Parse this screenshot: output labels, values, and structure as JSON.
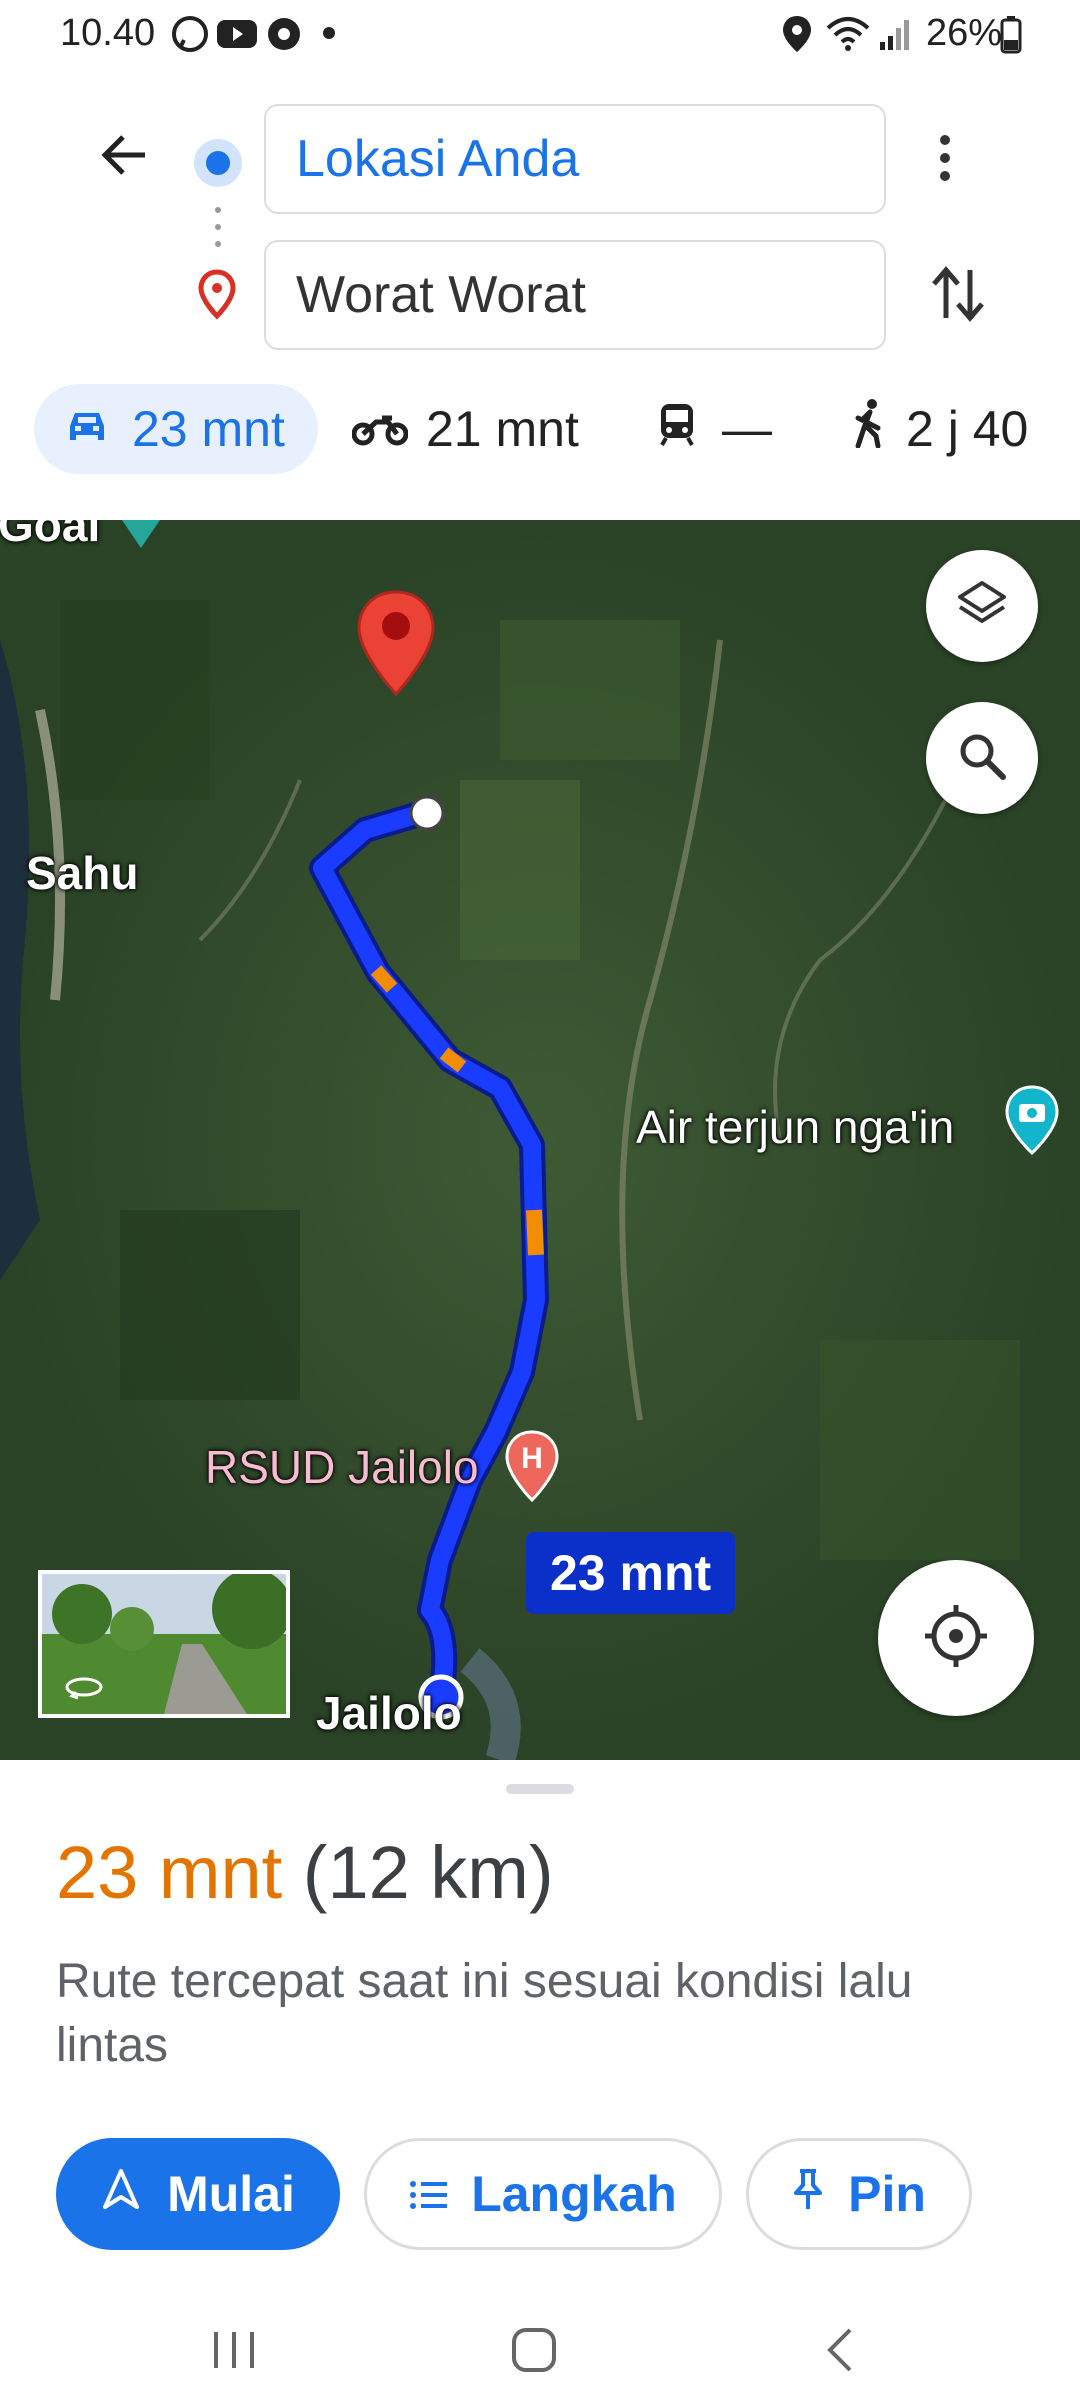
{
  "status_bar": {
    "time": "10.40",
    "battery": "26%"
  },
  "directions": {
    "origin": "Lokasi Anda",
    "destination": "Worat Worat"
  },
  "modes": [
    {
      "id": "car",
      "label": "23 mnt",
      "selected": true
    },
    {
      "id": "motorbike",
      "label": "21 mnt"
    },
    {
      "id": "transit",
      "label": "—"
    },
    {
      "id": "walk",
      "label": "2 j 40"
    }
  ],
  "map": {
    "labels": {
      "sahu": "Sahu",
      "air_terjun": "Air terjun nga'in",
      "rsud": "RSUD Jailolo",
      "jailolo": "Jailolo",
      "top_partial": "Goal"
    },
    "route_badge": "23 mnt",
    "colors": {
      "route": "#1a3cff",
      "traffic": "#f28c00",
      "badge": "#0b2fc9"
    }
  },
  "sheet": {
    "duration": "23 mnt",
    "distance": "(12 km)",
    "description": "Rute tercepat saat ini sesuai kondisi lalu lintas",
    "buttons": {
      "start": "Mulai",
      "steps": "Langkah",
      "pin": "Pin"
    }
  },
  "colors": {
    "accent": "#1a73e8",
    "duration": "#e37400"
  }
}
